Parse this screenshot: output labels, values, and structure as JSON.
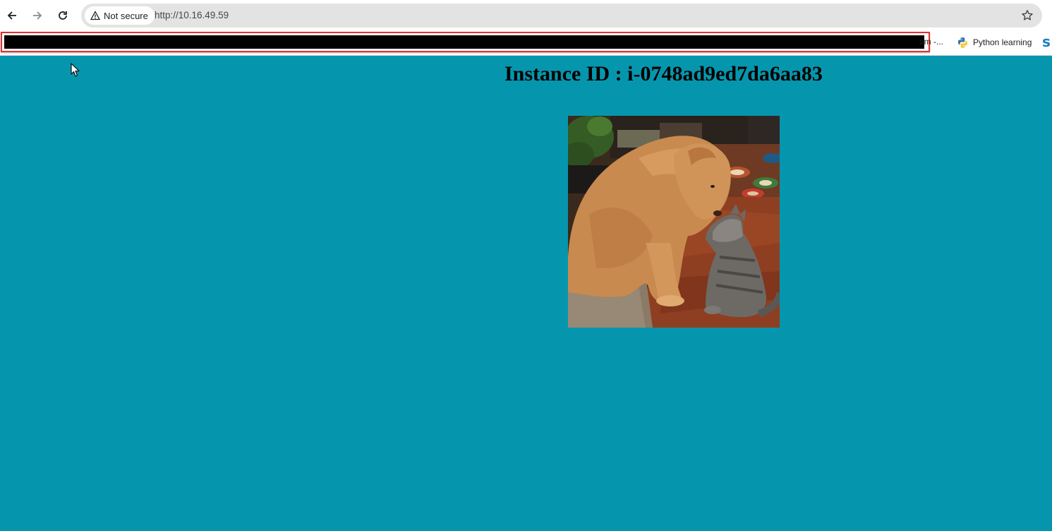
{
  "browser": {
    "security_label": "Not secure",
    "url": "http://10.16.49.59",
    "icons": {
      "back": "back-arrow-icon",
      "forward": "forward-arrow-icon",
      "reload": "reload-icon",
      "warning": "warning-triangle-icon",
      "bookmark": "star-icon"
    }
  },
  "bookmarks": {
    "truncated_label": "am -...",
    "python_label": "Python learning",
    "partial_label": "s"
  },
  "page": {
    "heading": "Instance ID : i-0748ad9ed7da6aa83",
    "image_description_alt": "",
    "background_color": "#0596ad"
  }
}
